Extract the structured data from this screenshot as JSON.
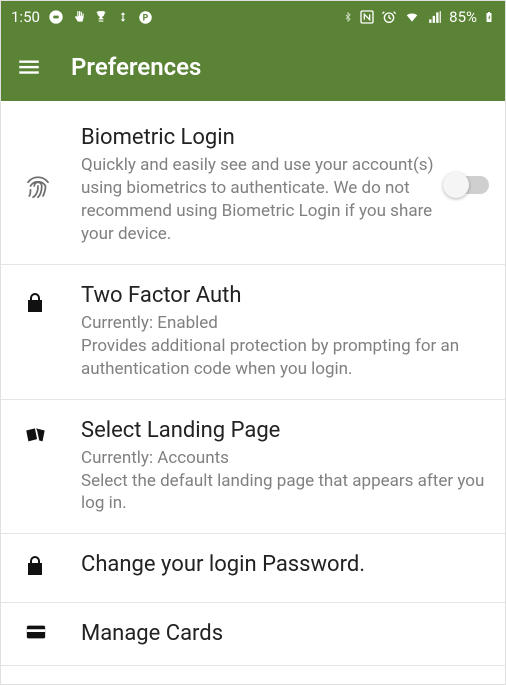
{
  "statusbar": {
    "time": "1:50",
    "battery_text": "85%"
  },
  "appbar": {
    "title": "Preferences"
  },
  "items": [
    {
      "title": "Biometric Login",
      "subtitle": "Quickly and easily see and use your account(s) using biometrics to authenticate. We do not recommend using Biometric Login if you share your device.",
      "toggle": false
    },
    {
      "title": "Two Factor Auth",
      "status_label": "Currently: Enabled",
      "subtitle": "Provides additional protection by prompting for an authentication code when you login."
    },
    {
      "title": "Select Landing Page",
      "status_label": "Currently: Accounts",
      "subtitle": "Select the default landing page that appears after you log in."
    },
    {
      "title": "Change your login Password."
    },
    {
      "title": "Manage Cards"
    }
  ]
}
